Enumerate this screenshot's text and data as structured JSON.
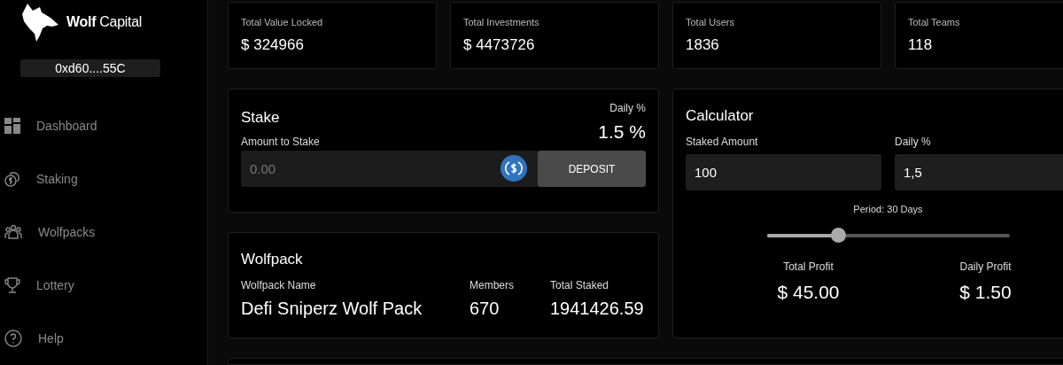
{
  "sidebar": {
    "brand": "**Wolf** Capital",
    "wallet": "0xd60....55C",
    "items": [
      {
        "label": "Dashboard",
        "kind": "dashboard",
        "selected": false
      },
      {
        "label": "Staking",
        "kind": "staking",
        "selected": false
      },
      {
        "label": "Wolfpacks",
        "kind": "groups",
        "selected": false
      },
      {
        "label": "Lottery",
        "kind": "lottery",
        "selected": false
      },
      {
        "label": "Help",
        "kind": "help",
        "selected": false
      }
    ]
  },
  "stats": [
    {
      "label": "Total Value Locked",
      "value": "$ 324966"
    },
    {
      "label": "Total Investments",
      "value": "$ 4473726"
    },
    {
      "label": "Total Users",
      "value": "1836"
    },
    {
      "label": "Total Teams",
      "value": "118"
    }
  ],
  "stake": {
    "title": "Stake",
    "amount_label": "Amount to Stake",
    "placeholder": "0.00",
    "daily_label": "Daily %",
    "daily_value": "1.5 %",
    "button": "DEPOSIT"
  },
  "wolfpack": {
    "title": "Wolfpack",
    "columns": [
      {
        "label": "Wolfpack Name",
        "value": "Defi Sniperz Wolf Pack"
      },
      {
        "label": "Members",
        "value": "670"
      },
      {
        "label": "Total Staked",
        "value": "1941426.59"
      }
    ]
  },
  "calculator": {
    "title": "Calculator",
    "staked_label": "Staked Amount",
    "staked_value": "100",
    "daily_label": "Daily %",
    "daily_value": "1,5",
    "period": "Period: 30 Days",
    "period_slider": {
      "level": 0.3
    },
    "results": [
      {
        "label": "Total Profit",
        "value": "$ 45.00"
      },
      {
        "label": "Daily Profit",
        "value": "$ 1.50"
      }
    ]
  }
}
